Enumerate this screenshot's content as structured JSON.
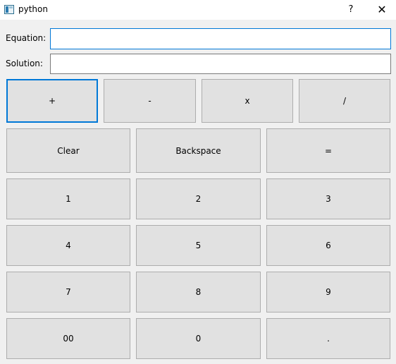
{
  "window": {
    "title": "python",
    "help_label": "?",
    "close_label": "✕"
  },
  "equation": {
    "label": "Equation:",
    "value": ""
  },
  "solution": {
    "label": "Solution:",
    "value": ""
  },
  "operators": {
    "plus": "+",
    "minus": "-",
    "multiply": "x",
    "divide": "/"
  },
  "controls": {
    "clear": "Clear",
    "backspace": "Backspace",
    "equals": "="
  },
  "digits": {
    "d1": "1",
    "d2": "2",
    "d3": "3",
    "d4": "4",
    "d5": "5",
    "d6": "6",
    "d7": "7",
    "d8": "8",
    "d9": "9",
    "d00": "00",
    "d0": "0",
    "dot": "."
  },
  "colors": {
    "focus": "#0078d7",
    "button_bg": "#e1e1e1",
    "button_border": "#adadad",
    "window_bg": "#f0f0f0"
  }
}
